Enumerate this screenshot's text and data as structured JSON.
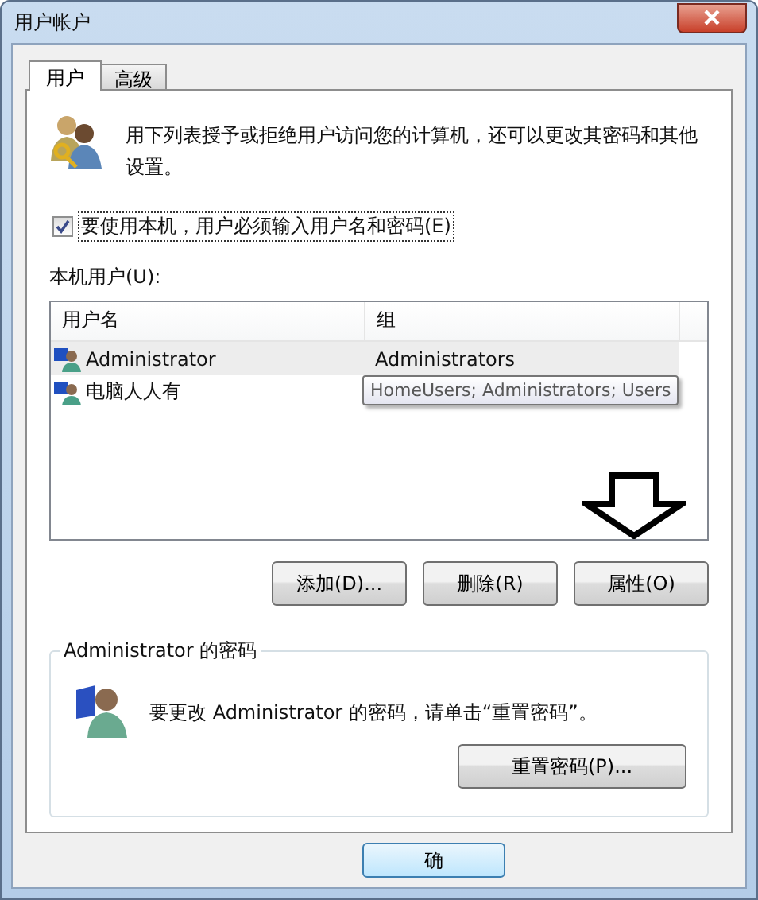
{
  "window": {
    "title": "用户帐户"
  },
  "tabs": [
    {
      "label": "用户",
      "selected": true
    },
    {
      "label": "高级",
      "selected": false
    }
  ],
  "intro": "用下列表授予或拒绝用户访问您的计算机，还可以更改其密码和其他设置。",
  "require_password": {
    "label": "要使用本机，用户必须输入用户名和密码(E)",
    "checked": true
  },
  "users_label": "本机用户(U):",
  "table": {
    "columns": [
      "用户名",
      "组"
    ],
    "rows": [
      {
        "name": "Administrator",
        "group": "Administrators",
        "selected": true
      },
      {
        "name": "电脑人人有",
        "group": "",
        "selected": false
      }
    ],
    "tooltip": "HomeUsers; Administrators; Users"
  },
  "buttons": [
    "添加(D)...",
    "删除(R)",
    "属性(O)"
  ],
  "password_group": {
    "title": "Administrator 的密码",
    "text": "要更改 Administrator 的密码，请单击“重置密码”。",
    "button": "重置密码(P)..."
  },
  "dialog_buttons": [
    "确"
  ]
}
